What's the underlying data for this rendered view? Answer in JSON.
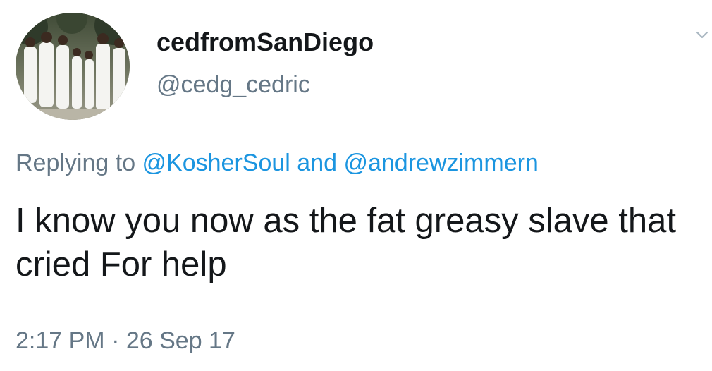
{
  "tweet": {
    "author": {
      "display_name": "cedfromSanDiego",
      "handle": "@cedg_cedric",
      "avatar": "group-photo-white-suits"
    },
    "reply_context": {
      "prefix": "Replying to ",
      "mentions": [
        "@KosherSoul",
        "@andrewzimmern"
      ],
      "joiner": " and "
    },
    "text": "I know you now as the fat greasy slave that cried For help",
    "timestamp": {
      "time": "2:17 PM",
      "separator": " · ",
      "date": "26 Sep 17"
    },
    "menu_icon": "chevron-down-icon"
  },
  "colors": {
    "text_primary": "#14171a",
    "text_secondary": "#657786",
    "link": "#1b95e0",
    "background": "#ffffff"
  }
}
